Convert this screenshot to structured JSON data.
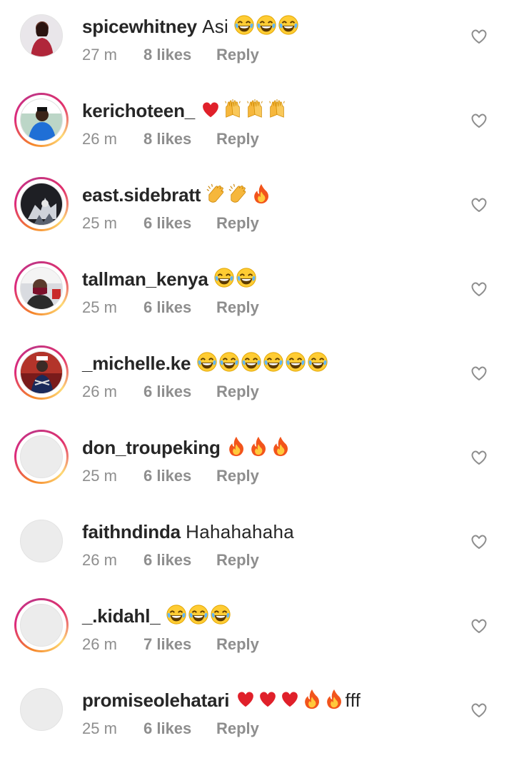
{
  "comments": [
    {
      "username": "spicewhitney",
      "text": "Asi",
      "emojis": [
        "laugh",
        "laugh",
        "laugh"
      ],
      "time": "27 m",
      "likes": "8 likes",
      "reply": "Reply",
      "ring": false,
      "avatar": "photo-woman-red"
    },
    {
      "username": "kerichoteen_",
      "text": "",
      "emojis": [
        "heart",
        "hands",
        "hands",
        "hands"
      ],
      "time": "26 m",
      "likes": "8 likes",
      "reply": "Reply",
      "ring": true,
      "avatar": "photo-man-blue"
    },
    {
      "username": "east.sidebratt",
      "text": "",
      "emojis": [
        "clap",
        "clap",
        "fire"
      ],
      "time": "25 m",
      "likes": "6 likes",
      "reply": "Reply",
      "ring": true,
      "avatar": "photo-dark-art"
    },
    {
      "username": "tallman_kenya",
      "text": "",
      "emojis": [
        "laugh",
        "laugh"
      ],
      "time": "25 m",
      "likes": "6 likes",
      "reply": "Reply",
      "ring": true,
      "avatar": "photo-man-masked"
    },
    {
      "username": "_michelle.ke",
      "text": "",
      "emojis": [
        "laugh",
        "laugh",
        "laugh",
        "laugh",
        "laugh",
        "laugh"
      ],
      "time": "26 m",
      "likes": "6 likes",
      "reply": "Reply",
      "ring": true,
      "avatar": "photo-red-room"
    },
    {
      "username": "don_troupeking",
      "text": "",
      "emojis": [
        "fire",
        "fire",
        "fire"
      ],
      "time": "25 m",
      "likes": "6 likes",
      "reply": "Reply",
      "ring": true,
      "avatar": "empty"
    },
    {
      "username": "faithndinda",
      "text": "Hahahahaha",
      "emojis": [],
      "time": "26 m",
      "likes": "6 likes",
      "reply": "Reply",
      "ring": false,
      "avatar": "empty"
    },
    {
      "username": "_.kidahl_",
      "text": "",
      "emojis": [
        "laugh",
        "laugh",
        "laugh"
      ],
      "time": "26 m",
      "likes": "7 likes",
      "reply": "Reply",
      "ring": true,
      "avatar": "empty"
    },
    {
      "username": "promiseolehatari",
      "text": "fff",
      "emojis": [
        "heart",
        "heart",
        "heart",
        "fire",
        "fire"
      ],
      "time": "25 m",
      "likes": "6 likes",
      "reply": "Reply",
      "ring": false,
      "avatar": "empty",
      "text_after_emojis": true
    }
  ],
  "colors": {
    "text": "#262626",
    "meta": "#8e8e8e",
    "heart_outline": "#8e8e8e"
  }
}
